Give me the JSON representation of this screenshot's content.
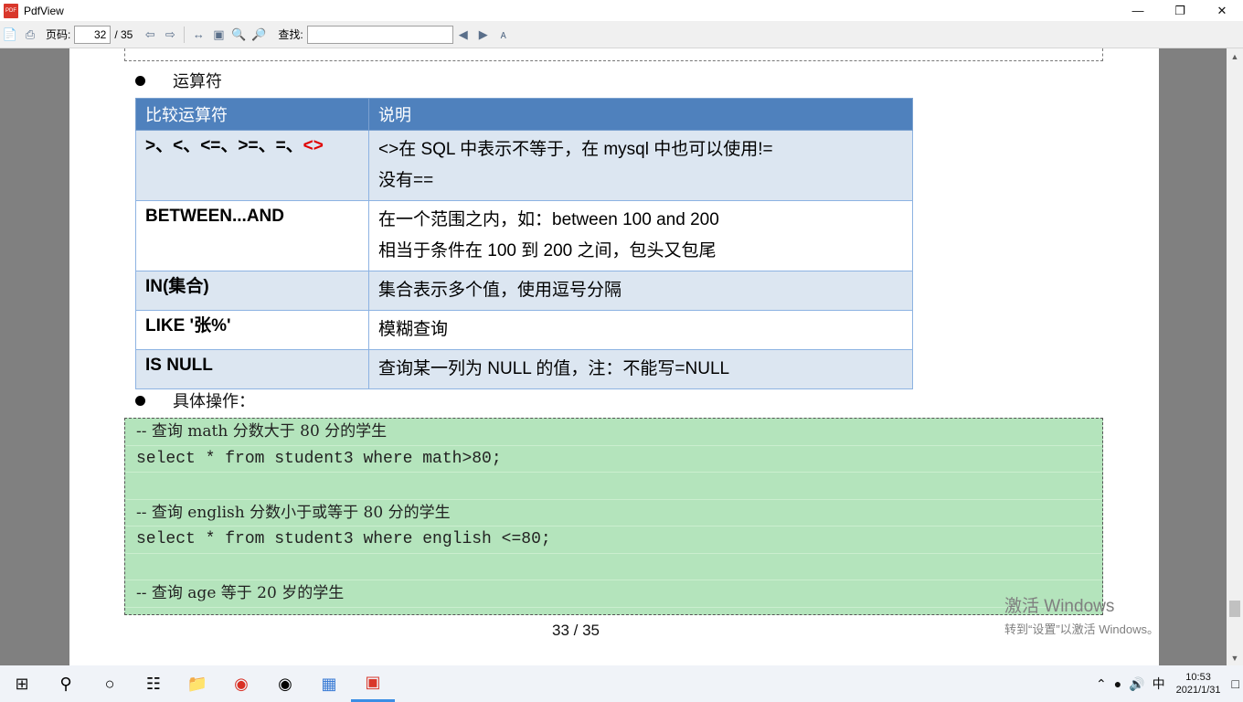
{
  "window": {
    "app_title": "PdfView",
    "app_icon_text": "PDF"
  },
  "toolbar": {
    "page_label": "页码:",
    "current_page": "32",
    "total_pages": "/ 35",
    "find_label": "查找:",
    "find_value": ""
  },
  "document": {
    "section_operators": "运算符",
    "table": {
      "headers": [
        "比较运算符",
        "说明"
      ],
      "rows": [
        {
          "op_plain": ">、<、<=、>=、=、",
          "op_red": "<>",
          "desc_lines": [
            "<>在 SQL 中表示不等于，在 mysql 中也可以使用!=",
            "没有=="
          ]
        },
        {
          "op_plain": "BETWEEN...AND",
          "op_red": "",
          "desc_lines": [
            "在一个范围之内，如：between 100 and 200",
            "相当于条件在 100 到 200 之间，包头又包尾"
          ]
        },
        {
          "op_plain": "IN(集合)",
          "op_red": "",
          "desc_lines": [
            "集合表示多个值，使用逗号分隔"
          ]
        },
        {
          "op_plain": "LIKE '张%'",
          "op_red": "",
          "desc_lines": [
            "模糊查询"
          ]
        },
        {
          "op_plain": "IS NULL",
          "op_red": "",
          "desc_lines": [
            "查询某一列为 NULL 的值，注：不能写=NULL"
          ]
        }
      ]
    },
    "section_ops": "具体操作：",
    "code_lines": [
      "-- 查询 math 分数大于 80 分的学生",
      "select * from student3 where math>80;",
      "",
      "-- 查询 english 分数小于或等于 80 分的学生",
      "select * from student3 where english <=80;",
      "",
      "-- 查询 age 等于 20 岁的学生"
    ],
    "page_number": "33 / 35"
  },
  "activation": {
    "line1": "激活 Windows",
    "line2": "转到“设置”以激活 Windows。"
  },
  "taskbar": {
    "input_method": "中",
    "time": "10:53",
    "date": "2021/1/31"
  }
}
